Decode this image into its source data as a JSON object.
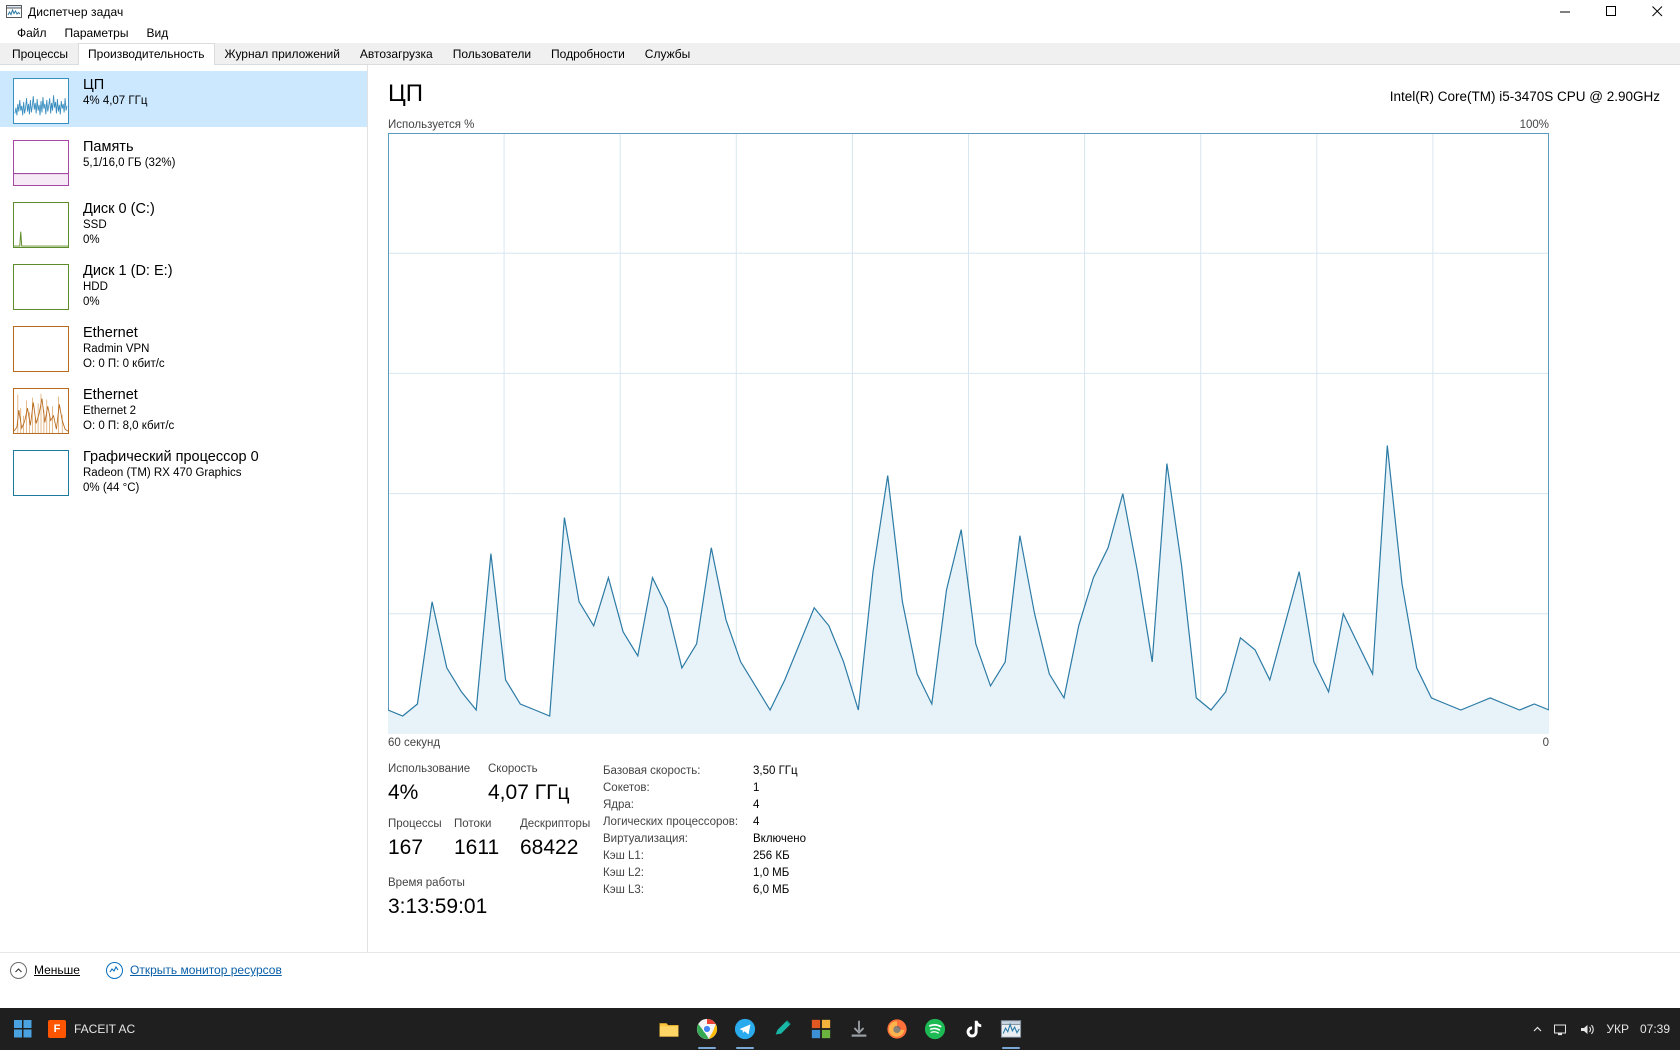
{
  "window": {
    "title": "Диспетчер задач",
    "icon": "task-manager-icon",
    "minimize_label": "─",
    "maximize_label": "❐",
    "close_label": "✕"
  },
  "menu": {
    "items": [
      {
        "label": "Файл"
      },
      {
        "label": "Параметры"
      },
      {
        "label": "Вид"
      }
    ]
  },
  "tabs": [
    {
      "label": "Процессы",
      "active": false
    },
    {
      "label": "Производительность",
      "active": true
    },
    {
      "label": "Журнал приложений",
      "active": false
    },
    {
      "label": "Автозагрузка",
      "active": false
    },
    {
      "label": "Пользователи",
      "active": false
    },
    {
      "label": "Подробности",
      "active": false
    },
    {
      "label": "Службы",
      "active": false
    }
  ],
  "sidebar": {
    "items": [
      {
        "name": "cpu",
        "title": "ЦП",
        "sub1": "4%  4,07 ГГц",
        "sub2": "",
        "selected": true,
        "color": "#3a8fc0",
        "thumb": "dense-noise"
      },
      {
        "name": "memory",
        "title": "Память",
        "sub1": "5,1/16,0 ГБ (32%)",
        "sub2": "",
        "selected": false,
        "color": "#a349a4",
        "thumb": "flat-band"
      },
      {
        "name": "disk0",
        "title": "Диск 0 (C:)",
        "sub1": "SSD",
        "sub2": "0%",
        "selected": false,
        "color": "#5f8c2a",
        "thumb": "one-spike"
      },
      {
        "name": "disk1",
        "title": "Диск 1 (D: E:)",
        "sub1": "HDD",
        "sub2": "0%",
        "selected": false,
        "color": "#5f8c2a",
        "thumb": "empty"
      },
      {
        "name": "ethernet-radmin",
        "title": "Ethernet",
        "sub1": "Radmin VPN",
        "sub2": "О: 0 П: 0 кбит/с",
        "selected": false,
        "color": "#b86a1f",
        "thumb": "empty"
      },
      {
        "name": "ethernet-2",
        "title": "Ethernet",
        "sub1": "Ethernet 2",
        "sub2": "О: 0 П: 8,0 кбит/с",
        "selected": false,
        "color": "#b86a1f",
        "thumb": "spiky"
      },
      {
        "name": "gpu0",
        "title": "Графический процессор 0",
        "sub1": "Radeon (TM) RX 470 Graphics",
        "sub2": "0%  (44 °C)",
        "selected": false,
        "color": "#1d7a9c",
        "thumb": "empty"
      }
    ]
  },
  "main": {
    "title": "ЦП",
    "model": "Intel(R) Core(TM) i5-3470S CPU @ 2.90GHz",
    "graph_top_left": "Используется %",
    "graph_top_right": "100%",
    "graph_bottom_left": "60 секунд",
    "graph_bottom_right": "0",
    "stats": {
      "utilization_label": "Использование",
      "utilization_value": "4%",
      "speed_label": "Скорость",
      "speed_value": "4,07 ГГц",
      "processes_label": "Процессы",
      "processes_value": "167",
      "threads_label": "Потоки",
      "threads_value": "1611",
      "handles_label": "Дескрипторы",
      "handles_value": "68422",
      "uptime_label": "Время работы",
      "uptime_value": "3:13:59:01"
    },
    "specs": [
      {
        "key": "Базовая скорость:",
        "value": "3,50 ГГц"
      },
      {
        "key": "Сокетов:",
        "value": "1"
      },
      {
        "key": "Ядра:",
        "value": "4"
      },
      {
        "key": "Логических процессоров:",
        "value": "4"
      },
      {
        "key": "Виртуализация:",
        "value": "Включено"
      },
      {
        "key": "Кэш L1:",
        "value": "256 КБ"
      },
      {
        "key": "Кэш L2:",
        "value": "1,0 МБ"
      },
      {
        "key": "Кэш L3:",
        "value": "6,0 МБ"
      }
    ]
  },
  "statusbar": {
    "less_label": "Меньше",
    "resource_monitor_label": "Открыть монитор ресурсов",
    "chevron_icon": "chevron-up-icon",
    "monitor_icon": "resource-monitor-icon"
  },
  "taskbar": {
    "start_icon": "windows-start-icon",
    "faceit_label": "FACEIT AC",
    "faceit_badge": "F",
    "apps": [
      {
        "name": "file-explorer",
        "icon": "folder-icon",
        "color": "#ffc53d",
        "running": false
      },
      {
        "name": "google-chrome",
        "icon": "chrome-icon",
        "color": "#4285f4",
        "running": true
      },
      {
        "name": "telegram",
        "icon": "telegram-icon",
        "color": "#2aabee",
        "running": true
      },
      {
        "name": "app-teal",
        "icon": "edit-icon",
        "color": "#19b5a5",
        "running": false
      },
      {
        "name": "app-multicolor",
        "icon": "palette-icon",
        "color": "#e25822",
        "running": false
      },
      {
        "name": "utorrent",
        "icon": "download-icon",
        "color": "#8a8a8a",
        "running": false
      },
      {
        "name": "firefox",
        "icon": "firefox-icon",
        "color": "#ff7139",
        "running": false
      },
      {
        "name": "spotify",
        "icon": "spotify-icon",
        "color": "#1db954",
        "running": false
      },
      {
        "name": "tiktok",
        "icon": "tiktok-icon",
        "color": "#ffffff",
        "running": false
      },
      {
        "name": "task-manager",
        "icon": "task-manager-icon",
        "color": "#9aa7b4",
        "running": true
      }
    ],
    "tray": {
      "chevron_label": "⌃",
      "network_icon": "network-icon",
      "volume_icon": "volume-icon",
      "language": "УКР",
      "time": "07:39"
    }
  },
  "chart_data": {
    "type": "area",
    "title": "ЦП — Используется %",
    "ylabel": "Используется %",
    "xlabel": "60 секунд",
    "ylim": [
      0,
      100
    ],
    "grid": true,
    "grid_cols": 10,
    "grid_rows": 5,
    "line_color": "#2c7ba5",
    "fill_color": "#e8f2f9",
    "values": [
      4,
      3,
      5,
      22,
      11,
      7,
      4,
      30,
      9,
      5,
      4,
      3,
      36,
      22,
      18,
      26,
      17,
      13,
      26,
      21,
      11,
      15,
      31,
      19,
      12,
      8,
      4,
      9,
      15,
      21,
      18,
      12,
      4,
      27,
      43,
      22,
      10,
      5,
      24,
      34,
      15,
      8,
      12,
      33,
      20,
      10,
      6,
      18,
      26,
      31,
      40,
      27,
      12,
      45,
      28,
      6,
      4,
      7,
      16,
      14,
      9,
      18,
      27,
      12,
      7,
      20,
      15,
      10,
      48,
      25,
      11,
      6,
      5,
      4,
      5,
      6,
      5,
      4,
      5,
      4
    ]
  }
}
